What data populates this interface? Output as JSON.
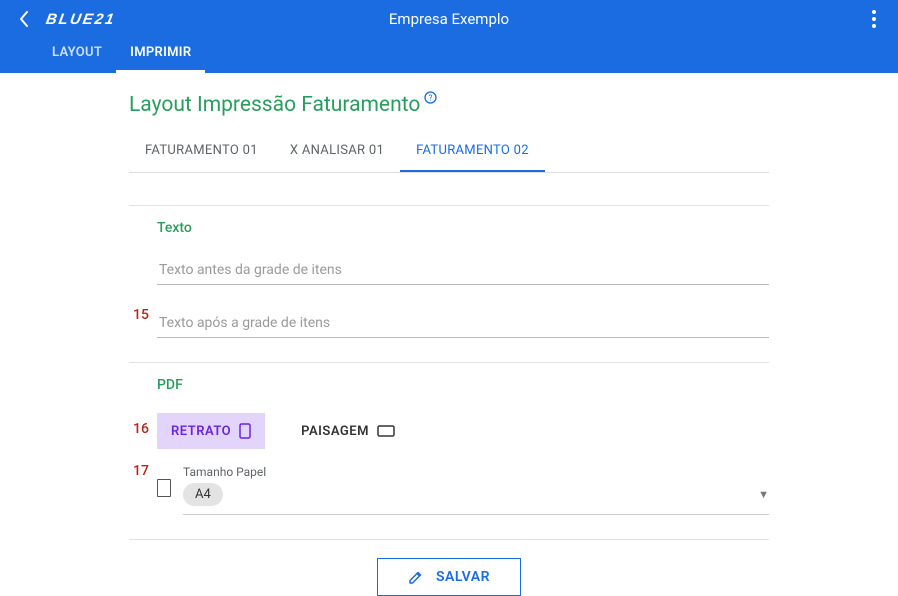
{
  "appbar": {
    "logo": "BLUE21",
    "title": "Empresa Exemplo"
  },
  "top_tabs": [
    {
      "label": "LAYOUT",
      "active": false
    },
    {
      "label": "IMPRIMIR",
      "active": true
    }
  ],
  "page": {
    "title": "Layout Impressão Faturamento"
  },
  "sub_tabs": [
    {
      "label": "FATURAMENTO 01",
      "active": false
    },
    {
      "label": "X ANALISAR 01",
      "active": false
    },
    {
      "label": "FATURAMENTO 02",
      "active": true
    }
  ],
  "texto": {
    "head": "Texto",
    "before_placeholder": "Texto antes da grade de itens",
    "after_placeholder": "Texto após a grade de itens"
  },
  "pdf": {
    "head": "PDF",
    "retrato": "RETRATO",
    "paisagem": "PAISAGEM",
    "paper_label": "Tamanho Papel",
    "paper_value": "A4"
  },
  "annotations": {
    "a15": "15",
    "a16": "16",
    "a17": "17"
  },
  "actions": {
    "save": "SALVAR"
  }
}
